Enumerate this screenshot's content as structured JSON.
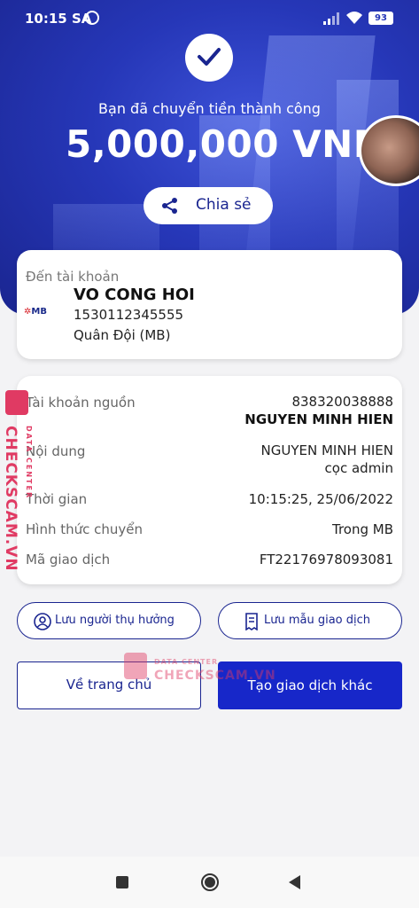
{
  "status_bar": {
    "time": "10:15 SA",
    "battery": "93"
  },
  "header": {
    "success_text": "Bạn đã chuyển tiền thành công",
    "amount": "5,000,000 VND",
    "share_label": "Chia sẻ"
  },
  "recipient": {
    "caption": "Đến tài khoản",
    "name": "VO CONG HOI",
    "account": "1530112345555",
    "bank": "Quân Đội (MB)",
    "bank_logo": "MB"
  },
  "details": {
    "source_label": "Tài khoản nguồn",
    "source_account": "838320038888",
    "source_name": "NGUYEN MINH HIEN",
    "content_label": "Nội dung",
    "content_line1": "NGUYEN MINH HIEN",
    "content_line2": "cọc admin",
    "time_label": "Thời gian",
    "time_value": "10:15:25, 25/06/2022",
    "method_label": "Hình thức chuyển",
    "method_value": "Trong MB",
    "txid_label": "Mã giao dịch",
    "txid_value": "FT22176978093081"
  },
  "actions": {
    "save_beneficiary": "Lưu người thụ hưởng",
    "save_template": "Lưu mẫu giao dịch",
    "home": "Về trang chủ",
    "new_transaction": "Tạo giao dịch khác"
  },
  "watermark": {
    "main": "CHECKSCAM.VN",
    "sub": "DATA CENTER"
  },
  "colors": {
    "primary": "#1a2590",
    "button_blue": "#1727c9",
    "watermark": "#e03a63"
  }
}
